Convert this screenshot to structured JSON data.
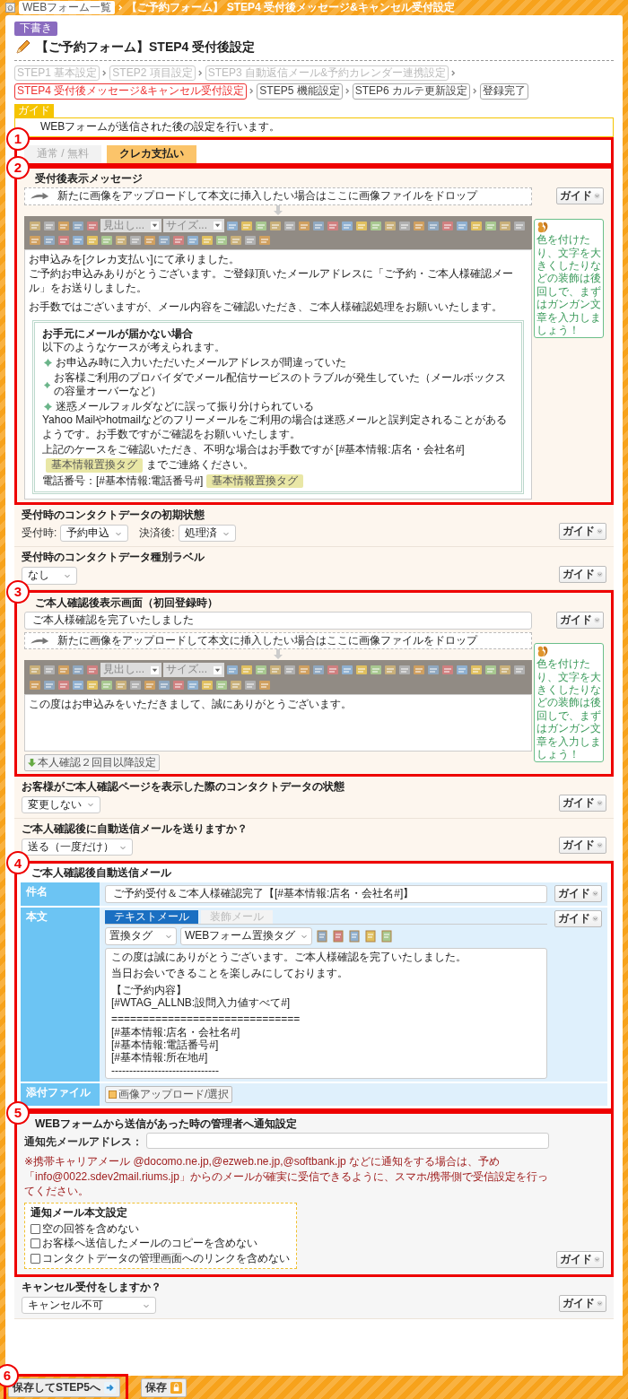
{
  "breadcrumb": [
    {
      "label": "WEBフォーム一覧"
    },
    {
      "label": "【ご予約フォーム】 STEP4 受付後メッセージ&キャンセル受付設定"
    }
  ],
  "status_badge": "下書き",
  "title": "【ご予約フォーム】STEP4 受付後設定",
  "steps": [
    {
      "label": "STEP1 基本設定",
      "selected": false,
      "completed": true
    },
    {
      "label": "STEP2 項目設定",
      "selected": false,
      "completed": true
    },
    {
      "label": "STEP3 自動返信メール&予約カレンダー連携設定",
      "selected": false,
      "completed": true
    },
    {
      "label": "STEP4 受付後メッセージ&キャンセル受付設定",
      "selected": true,
      "completed": false
    },
    {
      "label": "STEP5 機能設定",
      "selected": false,
      "completed": false
    },
    {
      "label": "STEP6 カルテ更新設定",
      "selected": false,
      "completed": false
    },
    {
      "label": "登録完了",
      "selected": false,
      "completed": false
    }
  ],
  "guide": {
    "label": "ガイド",
    "text": "WEBフォームが送信された後の設定を行います。"
  },
  "sections": [
    {
      "kind": "tabs",
      "annotation": "1",
      "tabs": [
        {
          "label": "通常 / 無料",
          "selected": false
        },
        {
          "label": "クレカ支払い",
          "selected": true
        }
      ]
    },
    {
      "kind": "editor",
      "annotation": "2",
      "heading": "受付後表示メッセージ",
      "guide": "ガイド",
      "drop_text": "新たに画像をアップロードして本文に挿入したい場合はここに画像ファイルをドロップ",
      "toolbar": {
        "heading_select": "見出し...",
        "size_select": "サイズ..."
      },
      "paragraphs": [
        [
          "お申込みを[クレカ支払い]にて承りました。",
          "ご予約お申込みありがとうございます。ご登録頂いたメールアドレスに「ご予約・ご本人様確認メール」をお送りしました。"
        ],
        [
          "お手数ではございますが、メール内容をご確認いただき、ご本人様確認処理をお願いいたします。"
        ]
      ],
      "notice": {
        "title": "お手元にメールが届かない場合",
        "intro": "以下のようなケースが考えられます。",
        "bullets": [
          "お申込み時に入力いただいたメールアドレスが間違っていた",
          "お客様ご利用のプロバイダでメール配信サービスのトラブルが発生していた（メールボックスの容量オーバーなど）",
          "迷惑メールフォルダなどに誤って振り分けられている"
        ],
        "note": "Yahoo Mailやhotmailなどのフリーメールをご利用の場合は迷惑メールと誤判定されることがあるようです。お手数ですがご確認をお願いいたします。",
        "tag_lines": [
          {
            "before": "上記のケースをご確認いただき、不明な場合はお手数ですが [#基本情報:店名・会社名#]",
            "tag": "基本情報置換タグ",
            "after": "までご連絡ください。"
          },
          {
            "before": "電話番号：[#基本情報:電話番号#]",
            "tag": "基本情報置換タグ"
          }
        ]
      },
      "tip": "色を付けたり、文字を大きくしたりなどの装飾は後回しで、まずはガンガン文章を入力しましょう！"
    },
    {
      "kind": "selects",
      "heading": "受付時のコンタクトデータの初期状態",
      "guide": "ガイド",
      "fields": [
        {
          "label": "受付時:",
          "value": "予約申込"
        },
        {
          "label": "決済後:",
          "value": "処理済"
        }
      ]
    },
    {
      "kind": "selects",
      "heading": "受付時のコンタクトデータ種別ラベル",
      "guide": "ガイド",
      "fields": [
        {
          "value": "なし"
        }
      ]
    },
    {
      "kind": "editor",
      "annotation": "3",
      "heading": "ご本人確認後表示画面（初回登録時）",
      "guide": "ガイド",
      "title_value": "ご本人様確認を完了いたしました",
      "drop_text": "新たに画像をアップロードして本文に挿入したい場合はここに画像ファイルをドロップ",
      "toolbar": {
        "heading_select": "見出し...",
        "size_select": "サイズ..."
      },
      "paragraphs": [
        [
          "この度はお申込みをいただきまして、誠にありがとうございます。"
        ]
      ],
      "tip": "色を付けたり、文字を大きくしたりなどの装飾は後回しで、まずはガンガン文章を入力しましょう！",
      "extra_button": "本人確認２回目以降設定"
    },
    {
      "kind": "selects",
      "heading": "お客様がご本人確認ページを表示した際のコンタクトデータの状態",
      "guide": "ガイド",
      "fields": [
        {
          "value": "変更しない"
        }
      ]
    },
    {
      "kind": "selects",
      "heading": "ご本人確認後に自動送信メールを送りますか？",
      "guide": "ガイド",
      "fields": [
        {
          "value": "送る（一度だけ）"
        }
      ]
    },
    {
      "kind": "mail",
      "annotation": "4",
      "heading": "ご本人確認後自動送信メール",
      "subject": {
        "label": "件名",
        "value": "ご予約受付＆ご本人様確認完了【[#基本情報:店名・会社名#]】",
        "guide": "ガイド"
      },
      "body": {
        "label": "本文",
        "guide": "ガイド",
        "tabs": [
          {
            "label": "テキストメール",
            "selected": true
          },
          {
            "label": "装飾メール",
            "selected": false
          }
        ],
        "selects": [
          "置換タグ",
          "WEBフォーム置換タグ"
        ],
        "paragraphs": [
          [
            "この度は誠にありがとうございます。ご本人様確認を完了いたしました。"
          ],
          [
            "当日お会いできることを楽しみにしております。"
          ],
          [
            "【ご予約内容】",
            "[#WTAG_ALLNB:設問入力値すべて#]"
          ],
          [
            "==============================",
            "[#基本情報:店名・会社名#]",
            "[#基本情報:電話番号#]",
            "[#基本情報:所在地#]",
            "------------------------------"
          ]
        ]
      },
      "attachment": {
        "label": "添付ファイル",
        "button": "画像アップロード/選択"
      }
    },
    {
      "kind": "notify",
      "annotation": "5",
      "heading": "WEBフォームから送信があった時の管理者へ通知設定",
      "guide": "ガイド",
      "address_label": "通知先メールアドレス：",
      "note": "※携帯キャリアメール @docomo.ne.jp,@ezweb.ne.jp,@softbank.jp などに通知をする場合は、予め「info@0022.sdev2mail.riums.jp」からのメールが確実に受信できるように、スマホ/携帯側で受信設定を行ってください。",
      "options": {
        "title": "通知メール本文設定",
        "items": [
          {
            "label": "空の回答を含めない",
            "checked": false
          },
          {
            "label": "お客様へ送信したメールのコピーを含めない",
            "checked": false
          },
          {
            "label": "コンタクトデータの管理画面へのリンクを含めない",
            "checked": false
          }
        ]
      }
    },
    {
      "kind": "selects",
      "heading": "キャンセル受付をしますか？",
      "guide": "ガイド",
      "fields": [
        {
          "value": "キャンセル不可"
        }
      ]
    }
  ],
  "footer": {
    "annotation": "6",
    "buttons": [
      {
        "label": "保存してSTEP5へ",
        "kind": "next"
      },
      {
        "label": "保存",
        "kind": "save"
      }
    ]
  }
}
